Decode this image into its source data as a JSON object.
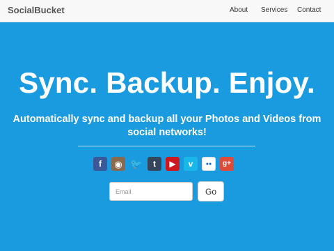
{
  "navbar": {
    "brand": "SocialBucket",
    "links": [
      {
        "label": "About"
      },
      {
        "label": "Services"
      },
      {
        "label": "Contact"
      }
    ]
  },
  "hero": {
    "headline": "Sync. Backup. Enjoy.",
    "subheadline": "Automatically sync and backup all your Photos and Videos from social networks!",
    "social_icons": [
      {
        "name": "facebook-icon",
        "glyph": "f",
        "color": "#3b5998"
      },
      {
        "name": "instagram-icon",
        "glyph": "◉",
        "color": "#8a6a4f"
      },
      {
        "name": "twitter-icon",
        "glyph": "🐦",
        "color": "#1a9be0"
      },
      {
        "name": "tumblr-icon",
        "glyph": "t",
        "color": "#35465c"
      },
      {
        "name": "youtube-icon",
        "glyph": "▶",
        "color": "#cc181e"
      },
      {
        "name": "vimeo-icon",
        "glyph": "v",
        "color": "#1ab7ea"
      },
      {
        "name": "flickr-icon",
        "glyph": "●●",
        "color": "#ffffff"
      },
      {
        "name": "google-plus-icon",
        "glyph": "g+",
        "color": "#dd4b39"
      }
    ]
  },
  "signup": {
    "email_placeholder": "Email",
    "email_value": "",
    "submit_label": "Go"
  },
  "colors": {
    "background": "#1a9be0",
    "navbar": "#f8f8f8"
  }
}
